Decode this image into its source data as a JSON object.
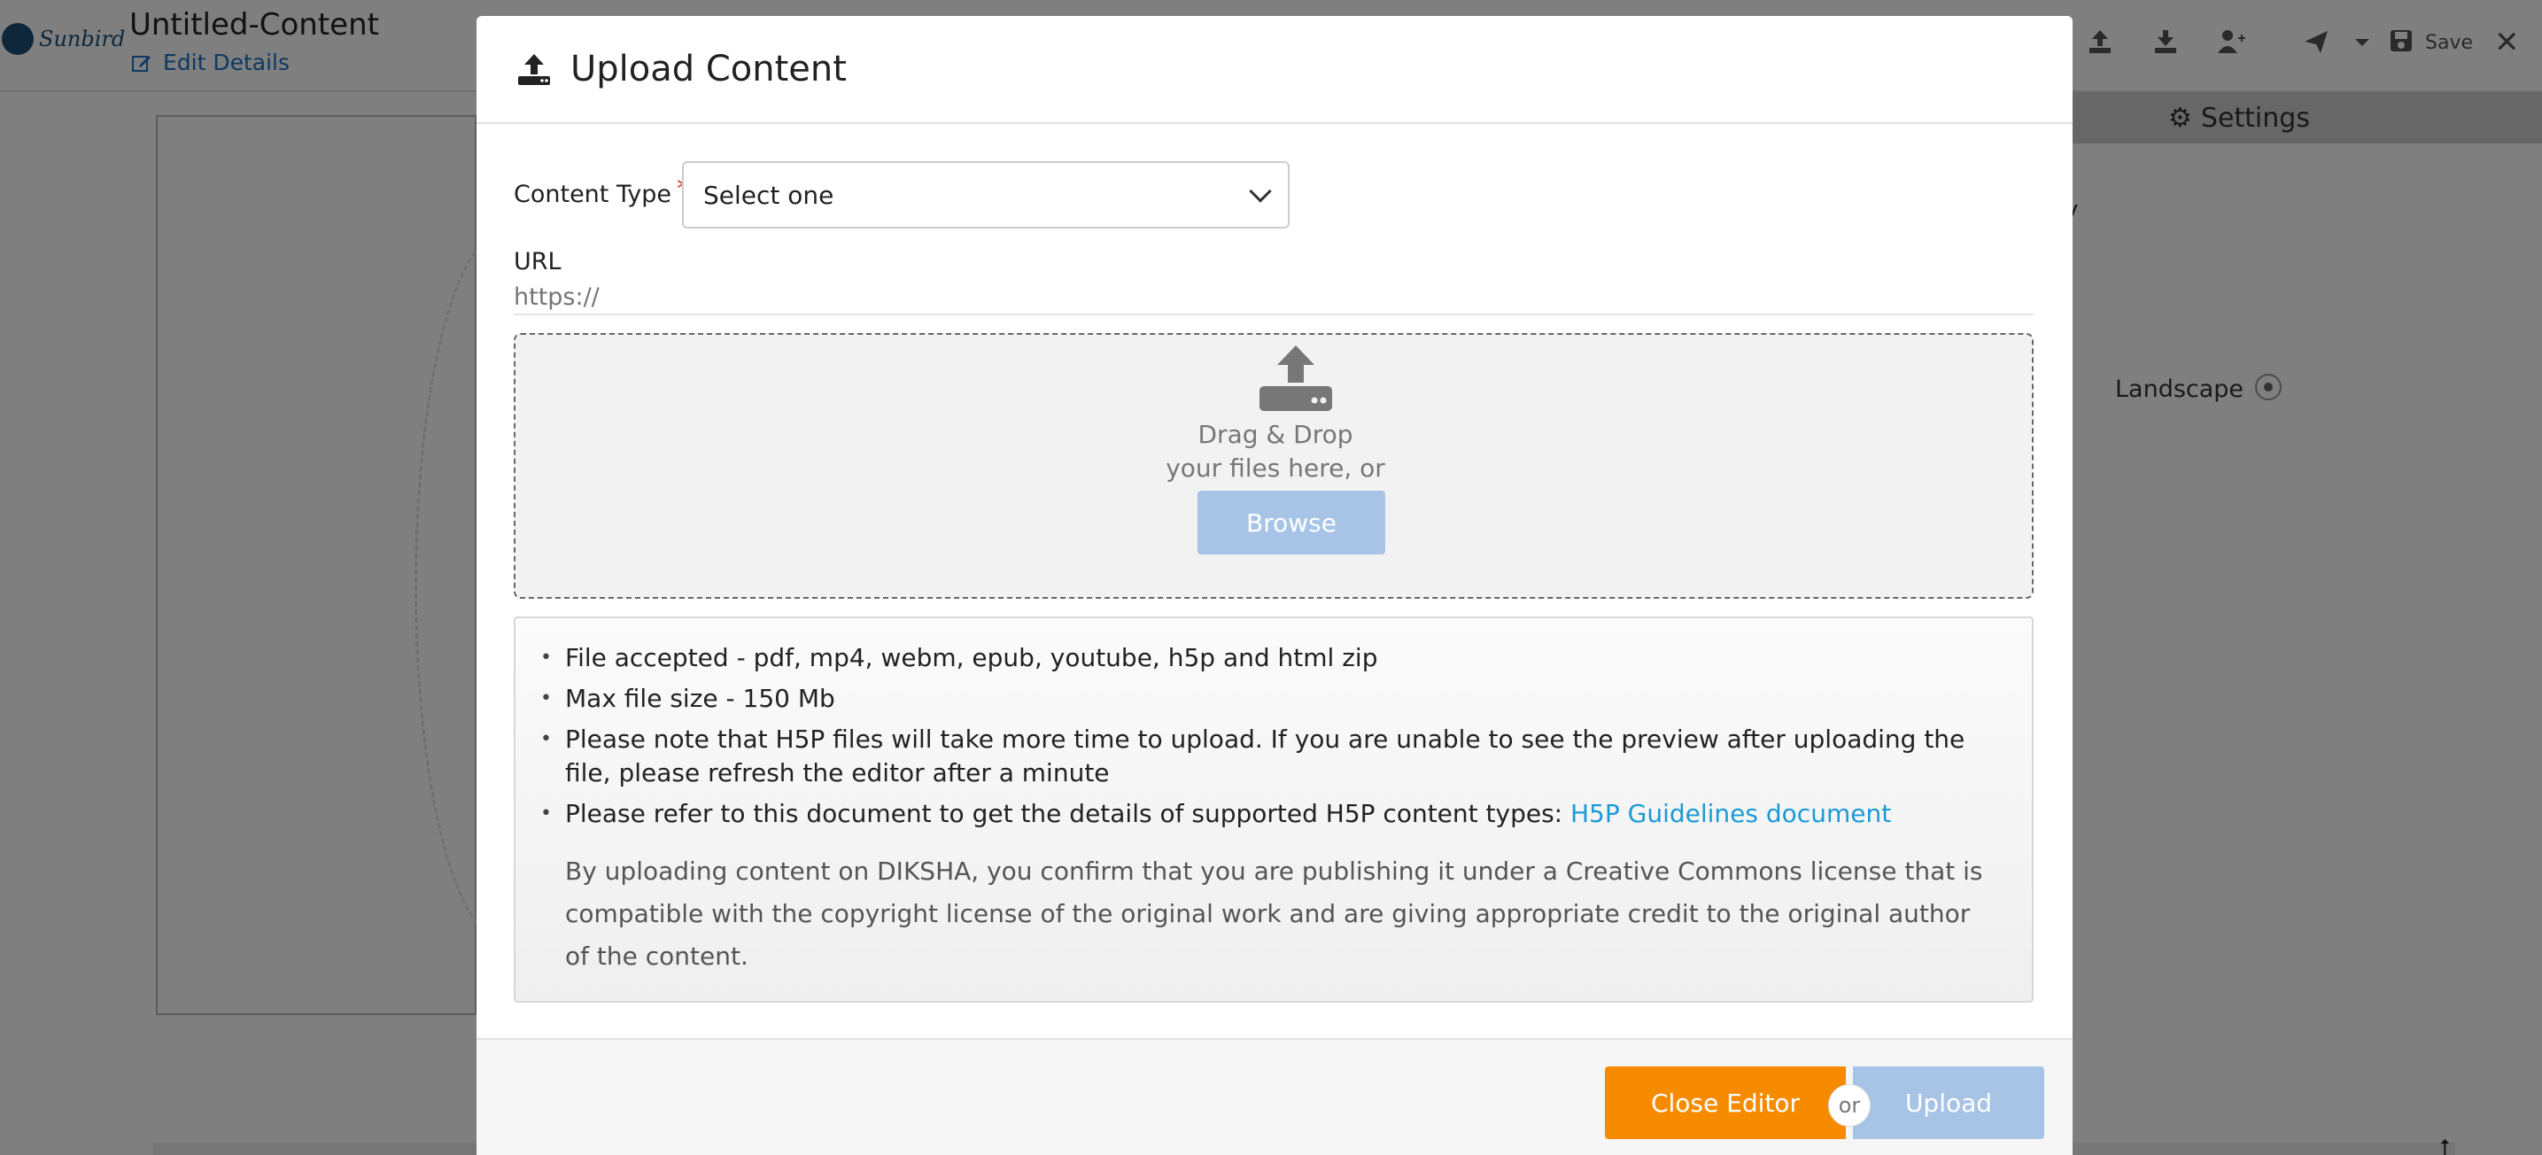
{
  "app": {
    "logo_text": "Sunbird",
    "doc_title": "Untitled-Content",
    "edit_details": "Edit Details",
    "save_label": "Save",
    "settings_label": "Settings",
    "settings_fragment": "y",
    "landscape_label": "Landscape",
    "icons": [
      "upload-icon",
      "download-icon",
      "add-user-icon",
      "send-icon",
      "caret-down-icon",
      "save-icon",
      "close-icon"
    ]
  },
  "modal": {
    "title": "Upload Content",
    "content_type_label": "Content Type",
    "required_mark": "*",
    "content_type_value": "Select one",
    "url_label": "URL",
    "url_placeholder": "https://",
    "dropzone": {
      "line1": "Drag & Drop",
      "line2": "your files here, or",
      "browse_label": "Browse"
    },
    "info": {
      "item1": "File accepted - pdf, mp4, webm, epub, youtube, h5p and html zip",
      "item2": "Max file size - 150 Mb",
      "item3": "Please note that H5P files will take more time to upload. If you are unable to see the preview after uploading the file, please refresh the editor after a minute",
      "item4_text": "Please refer to this document to get the details of supported H5P content types: ",
      "item4_link": "H5P Guidelines document",
      "license": "By uploading content on DIKSHA, you confirm that you are publishing it under a Creative Commons license that is compatible with the copyright license of the original work and are giving appropriate credit to the original author of the content."
    },
    "footer": {
      "close_label": "Close Editor",
      "or_label": "or",
      "upload_label": "Upload"
    }
  },
  "colors": {
    "accent_orange": "#f68b00",
    "disabled_blue": "#a7c3e6",
    "link_blue": "#1c9ad6",
    "required_red": "#db2828"
  }
}
